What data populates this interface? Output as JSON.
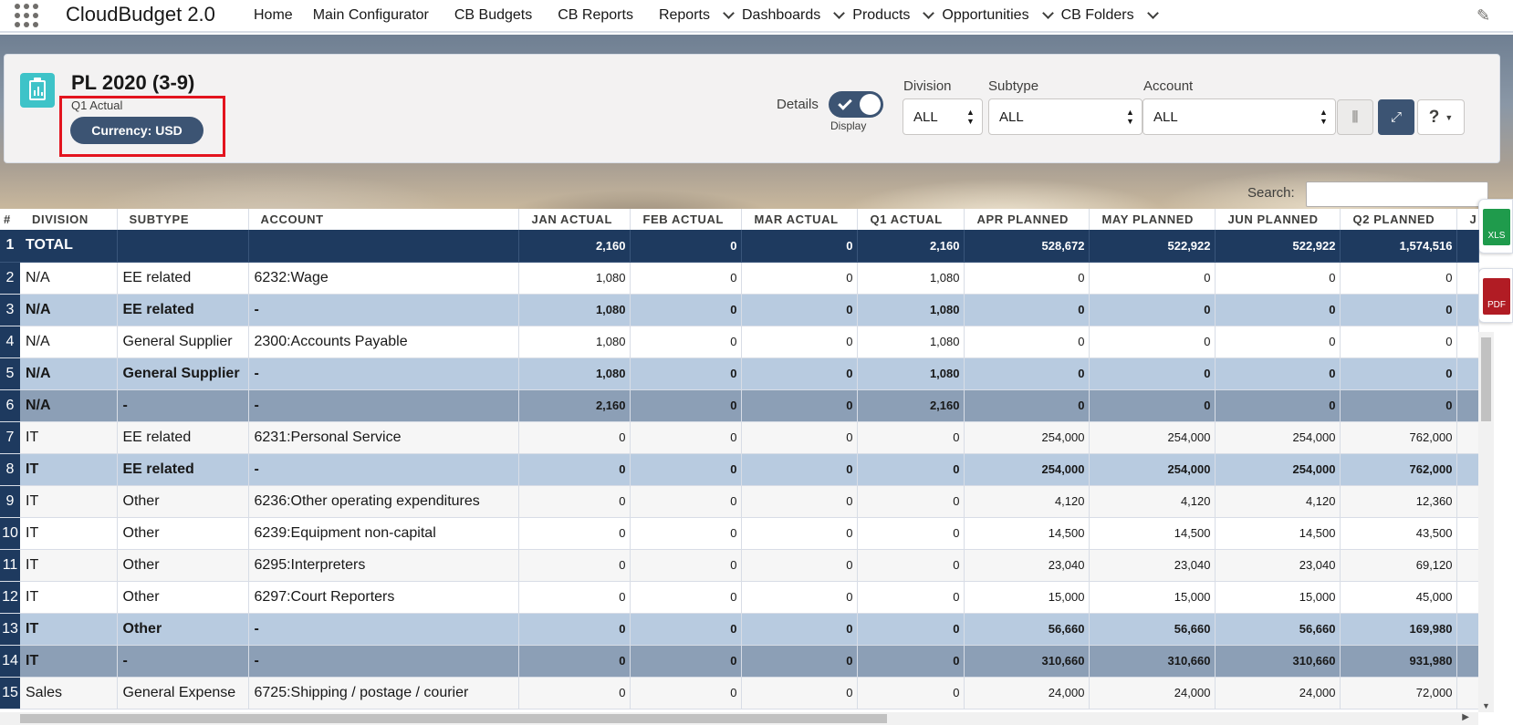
{
  "app": {
    "name": "CloudBudget 2.0"
  },
  "nav": [
    {
      "label": "Home",
      "dropdown": false
    },
    {
      "label": "Main Configurator",
      "dropdown": false
    },
    {
      "label": "CB Budgets",
      "dropdown": false
    },
    {
      "label": "CB Reports",
      "dropdown": false
    },
    {
      "label": "Reports",
      "dropdown": true
    },
    {
      "label": "Dashboards",
      "dropdown": true
    },
    {
      "label": "Products",
      "dropdown": true
    },
    {
      "label": "Opportunities",
      "dropdown": true
    },
    {
      "label": "CB Folders",
      "dropdown": true
    }
  ],
  "report": {
    "title": "PL 2020 (3-9)",
    "subtitle": "Q1 Actual",
    "currency_label": "Currency: USD"
  },
  "details": {
    "label": "Details",
    "toggle_on": true,
    "sub_label": "Display"
  },
  "filters": {
    "division": {
      "label": "Division",
      "value": "ALL"
    },
    "subtype": {
      "label": "Subtype",
      "value": "ALL"
    },
    "account": {
      "label": "Account",
      "value": "ALL"
    }
  },
  "search": {
    "label": "Search:",
    "value": ""
  },
  "exports": {
    "xls": "XLS",
    "pdf": "PDF"
  },
  "icons": {
    "app_launcher": "waffle-icon",
    "edit": "pencil-icon",
    "report": "report-clipboard-icon",
    "columns": "column-toggle-icon",
    "expand": "expand-icon",
    "help": "help-icon"
  },
  "colors": {
    "header_dark": "#1e3a5f",
    "subtotal": "#b8cbe0",
    "group_total": "#8c9fb6",
    "accent": "#3c5473",
    "highlight": "#e3141e"
  },
  "table": {
    "columns": [
      "#",
      "DIVISION",
      "SUBTYPE",
      "ACCOUNT",
      "JAN ACTUAL",
      "FEB ACTUAL",
      "MAR ACTUAL",
      "Q1 ACTUAL",
      "APR PLANNED",
      "MAY PLANNED",
      "JUN PLANNED",
      "Q2 PLANNED",
      "J"
    ],
    "rows": [
      {
        "n": "1",
        "type": "total",
        "division": "TOTAL",
        "subtype": "",
        "account": "",
        "values": [
          "2,160",
          "0",
          "0",
          "2,160",
          "528,672",
          "522,922",
          "522,922",
          "1,574,516"
        ]
      },
      {
        "n": "2",
        "type": "plain",
        "division": "N/A",
        "subtype": "EE related",
        "account": "6232:Wage",
        "values": [
          "1,080",
          "0",
          "0",
          "1,080",
          "0",
          "0",
          "0",
          "0"
        ]
      },
      {
        "n": "3",
        "type": "sub",
        "division": "N/A",
        "subtype": "EE related",
        "account": "-",
        "values": [
          "1,080",
          "0",
          "0",
          "1,080",
          "0",
          "0",
          "0",
          "0"
        ]
      },
      {
        "n": "4",
        "type": "plain",
        "division": "N/A",
        "subtype": "General Supplier",
        "account": "2300:Accounts Payable",
        "values": [
          "1,080",
          "0",
          "0",
          "1,080",
          "0",
          "0",
          "0",
          "0"
        ]
      },
      {
        "n": "5",
        "type": "sub",
        "division": "N/A",
        "subtype": "General Supplier",
        "account": "-",
        "values": [
          "1,080",
          "0",
          "0",
          "1,080",
          "0",
          "0",
          "0",
          "0"
        ]
      },
      {
        "n": "6",
        "type": "grand",
        "division": "N/A",
        "subtype": "-",
        "account": "-",
        "values": [
          "2,160",
          "0",
          "0",
          "2,160",
          "0",
          "0",
          "0",
          "0"
        ]
      },
      {
        "n": "7",
        "type": "plain",
        "division": "IT",
        "subtype": "EE related",
        "account": "6231:Personal Service",
        "values": [
          "0",
          "0",
          "0",
          "0",
          "254,000",
          "254,000",
          "254,000",
          "762,000"
        ]
      },
      {
        "n": "8",
        "type": "sub",
        "division": "IT",
        "subtype": "EE related",
        "account": "-",
        "values": [
          "0",
          "0",
          "0",
          "0",
          "254,000",
          "254,000",
          "254,000",
          "762,000"
        ]
      },
      {
        "n": "9",
        "type": "plain",
        "division": "IT",
        "subtype": "Other",
        "account": "6236:Other operating expenditures",
        "values": [
          "0",
          "0",
          "0",
          "0",
          "4,120",
          "4,120",
          "4,120",
          "12,360"
        ]
      },
      {
        "n": "10",
        "type": "plain",
        "division": "IT",
        "subtype": "Other",
        "account": "6239:Equipment non-capital",
        "values": [
          "0",
          "0",
          "0",
          "0",
          "14,500",
          "14,500",
          "14,500",
          "43,500"
        ]
      },
      {
        "n": "11",
        "type": "plain",
        "division": "IT",
        "subtype": "Other",
        "account": "6295:Interpreters",
        "values": [
          "0",
          "0",
          "0",
          "0",
          "23,040",
          "23,040",
          "23,040",
          "69,120"
        ]
      },
      {
        "n": "12",
        "type": "plain",
        "division": "IT",
        "subtype": "Other",
        "account": "6297:Court Reporters",
        "values": [
          "0",
          "0",
          "0",
          "0",
          "15,000",
          "15,000",
          "15,000",
          "45,000"
        ]
      },
      {
        "n": "13",
        "type": "sub",
        "division": "IT",
        "subtype": "Other",
        "account": "-",
        "values": [
          "0",
          "0",
          "0",
          "0",
          "56,660",
          "56,660",
          "56,660",
          "169,980"
        ]
      },
      {
        "n": "14",
        "type": "grand",
        "division": "IT",
        "subtype": "-",
        "account": "-",
        "values": [
          "0",
          "0",
          "0",
          "0",
          "310,660",
          "310,660",
          "310,660",
          "931,980"
        ]
      },
      {
        "n": "15",
        "type": "plain",
        "division": "Sales",
        "subtype": "General Expense",
        "account": "6725:Shipping / postage / courier",
        "values": [
          "0",
          "0",
          "0",
          "0",
          "24,000",
          "24,000",
          "24,000",
          "72,000"
        ]
      }
    ]
  }
}
